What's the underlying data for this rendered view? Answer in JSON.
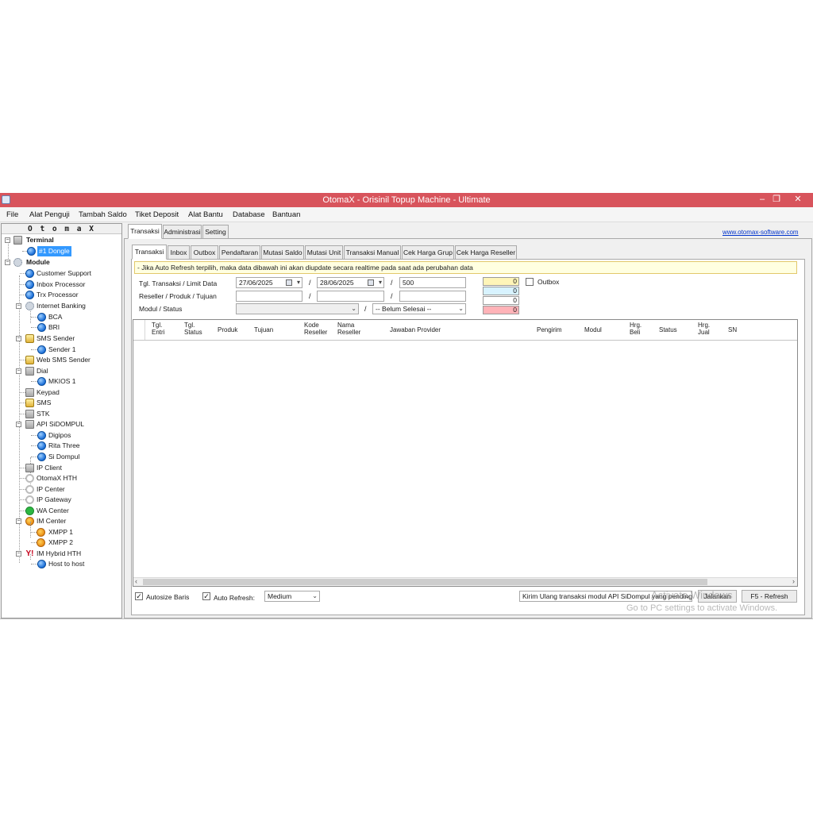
{
  "window": {
    "title": "OtomaX - Orisinil Topup Machine - Ultimate",
    "minimize": "–",
    "maximize": "❐",
    "close": "✕"
  },
  "menu": [
    "File",
    "Alat Penguji",
    "Tambah Saldo",
    "Tiket Deposit",
    "Alat Bantu",
    "Database",
    "Bantuan"
  ],
  "tree": {
    "header": "O t o m a X",
    "terminal_label": "Terminal",
    "terminal_items": [
      "#1 Dongle"
    ],
    "module_label": "Module",
    "items": [
      "Customer Support",
      "Inbox Processor",
      "Trx Processor",
      "Internet Banking",
      "BCA",
      "BRI",
      "SMS Sender",
      "Sender 1",
      "Web SMS Sender",
      "Dial",
      "MKIOS 1",
      "Keypad",
      "SMS",
      "STK",
      "API SiDOMPUL",
      "Digipos",
      "Rita Three",
      "Si Dompul",
      "IP Client",
      "OtomaX HTH",
      "IP Center",
      "IP Gateway",
      "WA Center",
      "IM Center",
      "XMPP 1",
      "XMPP 2",
      "IM Hybrid HTH",
      "Host to host"
    ]
  },
  "main_tabs": [
    "Transaksi",
    "Administrasi",
    "Setting"
  ],
  "website_link": "www.otomax-software.com",
  "sub_tabs": [
    "Transaksi",
    "Inbox",
    "Outbox",
    "Pendaftaran",
    "Mutasi Saldo",
    "Mutasi Unit",
    "Transaksi Manual",
    "Cek Harga Grup",
    "Cek Harga Reseller"
  ],
  "notice": "- Jika Auto Refresh terpilih, maka data dibawah ini akan diupdate secara realtime pada saat ada perubahan data",
  "filters": {
    "label_tgl": "Tgl. Transaksi / Limit Data",
    "label_reseller": "Reseller / Produk / Tujuan",
    "label_modul": "Modul / Status",
    "date_from": "27/06/2025",
    "date_to": "28/06/2025",
    "limit": "500",
    "reseller": "",
    "produk": "",
    "tujuan": "",
    "modul": "",
    "status": "-- Belum Selesai --",
    "slash": "/"
  },
  "counters": [
    "0",
    "0",
    "0",
    "0"
  ],
  "counter_colors": [
    "#fff5b8",
    "#d8f3ff",
    "#ffffff",
    "#ffb3b8"
  ],
  "outbox_label": "Outbox",
  "columns": [
    "Tgl.\nEntri",
    "Tgl.\nStatus",
    "Produk",
    "Tujuan",
    "Kode\nReseller",
    "Nama\nReseller",
    "Jawaban Provider",
    "Pengirim",
    "Modul",
    "Hrg.\nBeli",
    "Status",
    "Hrg.\nJual",
    "SN"
  ],
  "scroll_left": "‹",
  "scroll_right": "›",
  "bottom": {
    "autosize_label": "Autosize Baris",
    "autorefresh_label": "Auto Refresh:",
    "refresh_speed": "Medium",
    "action_select": "Kirim Ulang transaksi modul API SiDompul yang pending",
    "run_button": "Jalankan",
    "refresh_button": "F5 - Refresh",
    "check": "✓"
  },
  "watermark": {
    "line1": "Activate Windows",
    "line2": "Go to PC settings to activate Windows."
  }
}
